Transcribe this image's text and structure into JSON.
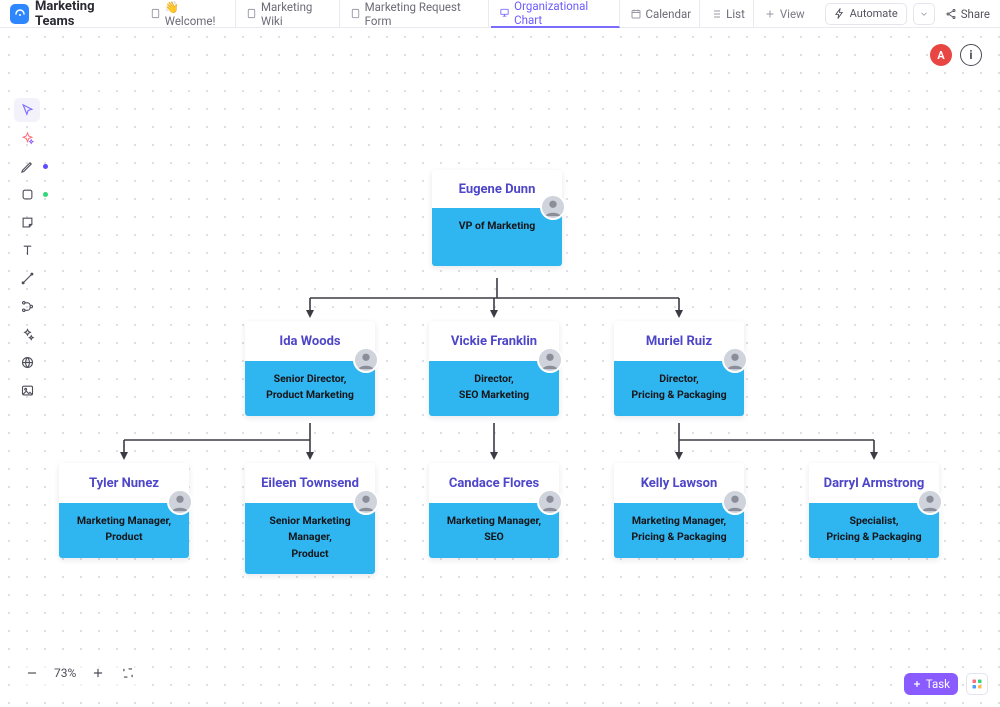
{
  "header": {
    "title": "Marketing Teams",
    "tabs": [
      {
        "label": "👋 Welcome!",
        "icon": "doc"
      },
      {
        "label": "Marketing Wiki",
        "icon": "doc"
      },
      {
        "label": "Marketing Request Form",
        "icon": "doc"
      },
      {
        "label": "Organizational Chart",
        "icon": "whiteboard",
        "active": true
      },
      {
        "label": "Calendar",
        "icon": "calendar"
      },
      {
        "label": "List",
        "icon": "list"
      }
    ],
    "addView": "View",
    "automate": "Automate",
    "share": "Share"
  },
  "corner": {
    "avatarInitial": "A"
  },
  "zoom": {
    "percent": "73%"
  },
  "task": {
    "label": "Task"
  },
  "nodes": {
    "root": {
      "name": "Eugene Dunn",
      "role_l1": "VP of Marketing",
      "role_l2": ""
    },
    "l1a": {
      "name": "Ida Woods",
      "role_l1": "Senior Director,",
      "role_l2": "Product Marketing"
    },
    "l1b": {
      "name": "Vickie Franklin",
      "role_l1": "Director,",
      "role_l2": "SEO Marketing"
    },
    "l1c": {
      "name": "Muriel Ruiz",
      "role_l1": "Director,",
      "role_l2": "Pricing & Packaging"
    },
    "l2a": {
      "name": "Tyler Nunez",
      "role_l1": "Marketing Manager,",
      "role_l2": "Product"
    },
    "l2b": {
      "name": "Eileen Townsend",
      "role_l1": "Senior Marketing Manager,",
      "role_l2": "Product"
    },
    "l2c": {
      "name": "Candace Flores",
      "role_l1": "Marketing Manager,",
      "role_l2": "SEO"
    },
    "l2d": {
      "name": "Kelly Lawson",
      "role_l1": "Marketing Manager,",
      "role_l2": "Pricing & Packaging"
    },
    "l2e": {
      "name": "Darryl Armstrong",
      "role_l1": "Specialist,",
      "role_l2": "Pricing & Packaging"
    }
  },
  "chart_data": {
    "type": "org-tree",
    "title": "Organizational Chart",
    "root": {
      "name": "Eugene Dunn",
      "role": "VP of Marketing",
      "children": [
        {
          "name": "Ida Woods",
          "role": "Senior Director, Product Marketing",
          "children": [
            {
              "name": "Tyler Nunez",
              "role": "Marketing Manager, Product"
            },
            {
              "name": "Eileen Townsend",
              "role": "Senior Marketing Manager, Product"
            }
          ]
        },
        {
          "name": "Vickie Franklin",
          "role": "Director, SEO Marketing",
          "children": [
            {
              "name": "Candace Flores",
              "role": "Marketing Manager, SEO"
            }
          ]
        },
        {
          "name": "Muriel Ruiz",
          "role": "Director, Pricing & Packaging",
          "children": [
            {
              "name": "Kelly Lawson",
              "role": "Marketing Manager, Pricing & Packaging"
            },
            {
              "name": "Darryl Armstrong",
              "role": "Specialist, Pricing & Packaging"
            }
          ]
        }
      ]
    }
  }
}
